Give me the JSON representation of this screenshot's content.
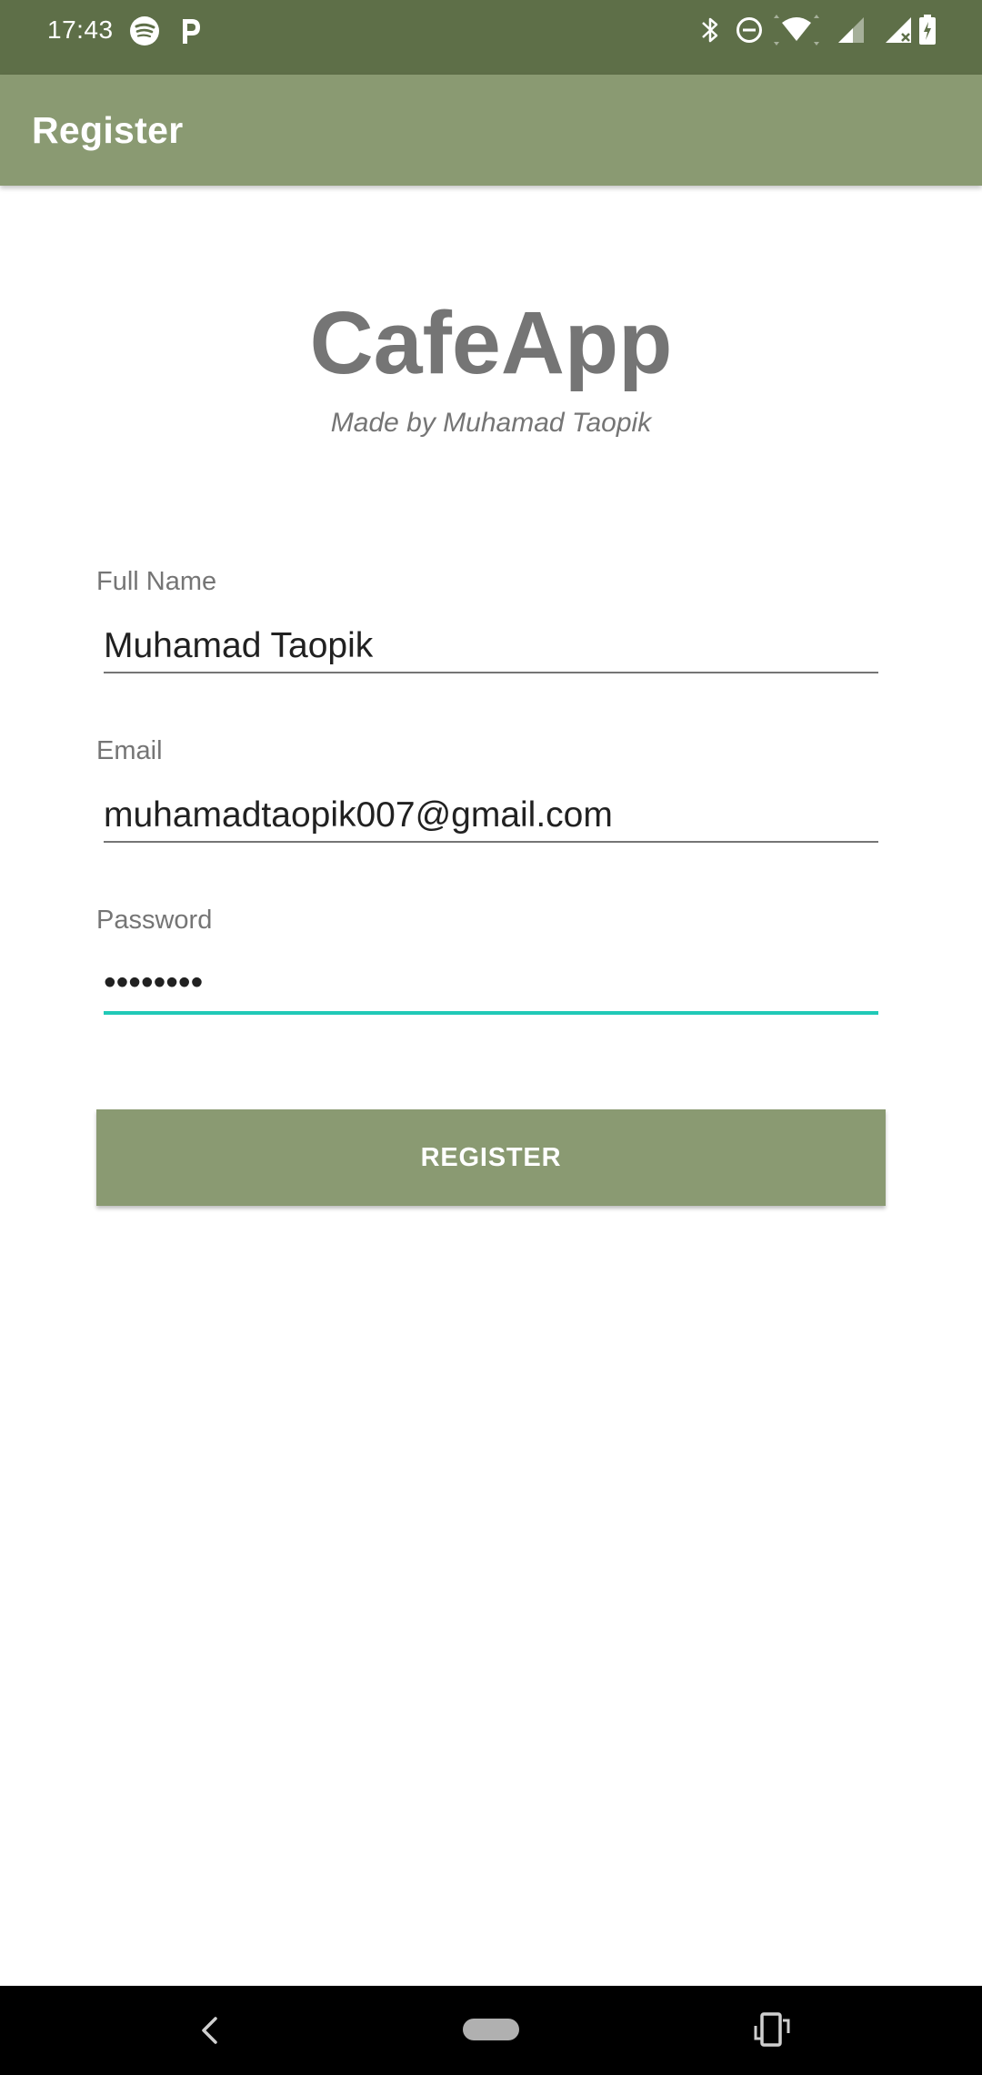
{
  "status_bar": {
    "time": "17:43",
    "left_icons": [
      "spotify-icon",
      "p-app-icon"
    ],
    "right_icons": [
      "bluetooth-icon",
      "do-not-disturb-icon",
      "wifi-icon",
      "signal-icon",
      "signal-icon",
      "battery-icon"
    ],
    "background": "#5e6f48"
  },
  "app_bar": {
    "title": "Register",
    "background": "#8a9a72"
  },
  "logo": {
    "title": "CafeApp",
    "subtitle": "Made by Muhamad Taopik"
  },
  "form": {
    "full_name": {
      "label": "Full Name",
      "value": "Muhamad Taopik"
    },
    "email": {
      "label": "Email",
      "value": "muhamadtaopik007@gmail.com"
    },
    "password": {
      "label": "Password",
      "value": "••••••••",
      "focused": true
    },
    "register_label": "REGISTER"
  },
  "nav_bar": {
    "icons": [
      "back-icon",
      "home-pill-icon",
      "rotate-icon"
    ]
  },
  "colors": {
    "accent": "#20c9b7",
    "primary": "#8a9a72",
    "primary_dark": "#5e6f48",
    "text_secondary": "#757575"
  }
}
